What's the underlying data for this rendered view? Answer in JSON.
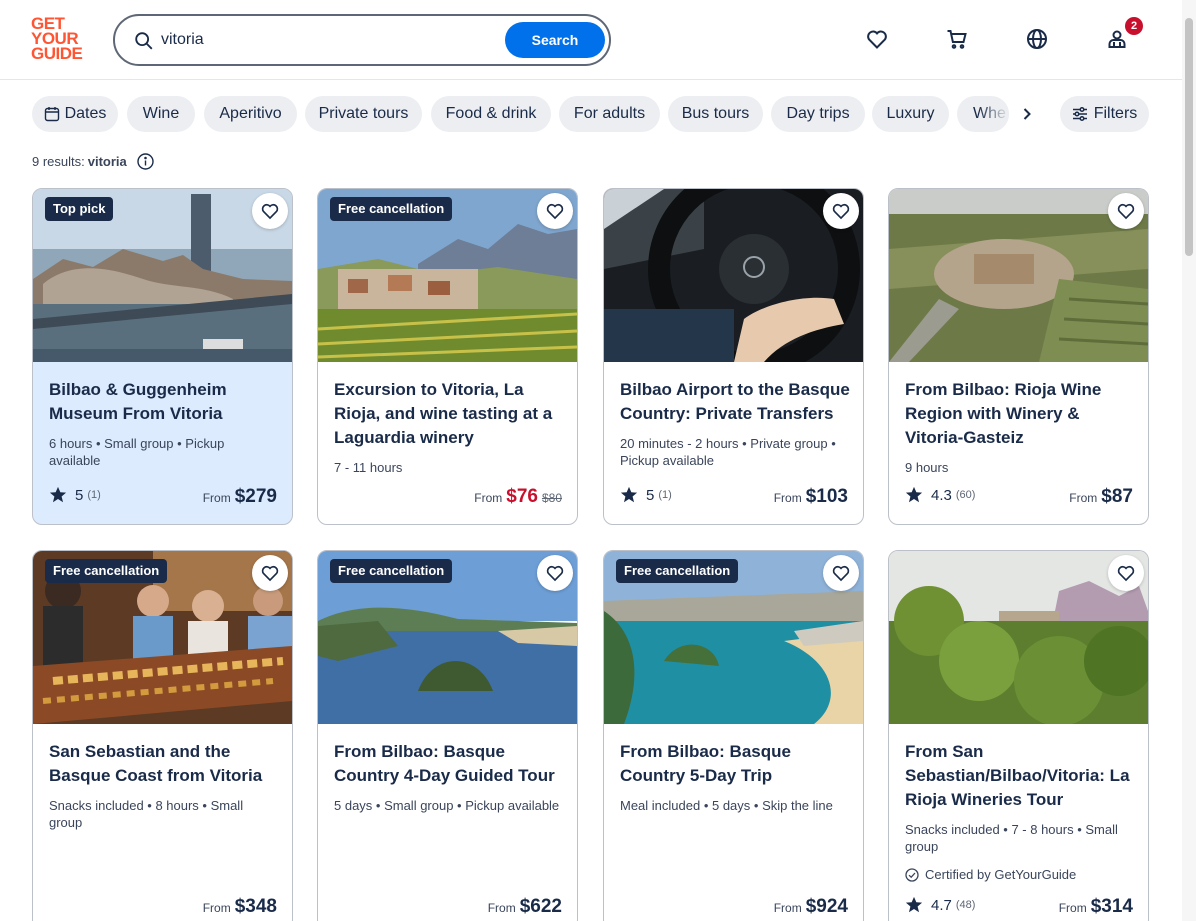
{
  "header": {
    "logo_lines": [
      "GET",
      "YOUR",
      "GUIDE"
    ],
    "search_value": "vitoria",
    "search_button": "Search",
    "cart_badge": "2",
    "icons": [
      "heart-icon",
      "cart-icon",
      "globe-icon",
      "user-icon"
    ]
  },
  "chips": [
    "Dates",
    "Wine",
    "Aperitivo",
    "Private tours",
    "Food & drink",
    "For adults",
    "Bus tours",
    "Day trips",
    "Luxury",
    "Whe"
  ],
  "filters_label": "Filters",
  "results_label": "9 results: ",
  "results_query": "vitoria",
  "colors": {
    "brand": "#ff5533",
    "accent": "#0071eb",
    "navy": "#1a2b49",
    "sale": "#c8102e"
  },
  "cards": [
    {
      "tag": "Top pick",
      "title": "Bilbao & Guggenheim Museum From Vitoria",
      "meta": "6 hours • Small group • Pickup available",
      "rating": "5",
      "reviews": "(1)",
      "from": "From",
      "price": "$279"
    },
    {
      "tag": "Free cancellation",
      "title": "Excursion to Vitoria, La Rioja, and wine tasting at a Laguardia winery",
      "meta": "7 - 11 hours",
      "from": "From",
      "price": "$76",
      "old_price": "$80"
    },
    {
      "title": "Bilbao Airport to the Basque Country: Private Transfers",
      "meta": "20 minutes - 2 hours • Private group • Pickup available",
      "rating": "5",
      "reviews": "(1)",
      "from": "From",
      "price": "$103"
    },
    {
      "title": "From Bilbao: Rioja Wine Region with Winery & Vitoria-Gasteiz",
      "meta": "9 hours",
      "rating": "4.3",
      "reviews": "(60)",
      "from": "From",
      "price": "$87"
    },
    {
      "tag": "Free cancellation",
      "title": "San Sebastian and the Basque Coast from Vitoria",
      "meta": "Snacks included • 8 hours • Small group",
      "from": "From",
      "price": "$348"
    },
    {
      "tag": "Free cancellation",
      "title": "From Bilbao: Basque Country 4-Day Guided Tour",
      "meta": "5 days • Small group • Pickup available",
      "from": "From",
      "price": "$622"
    },
    {
      "tag": "Free cancellation",
      "title": "From Bilbao: Basque Country 5-Day Trip",
      "meta": "Meal included • 5 days • Skip the line",
      "from": "From",
      "price": "$924"
    },
    {
      "title": "From San Sebastian/Bilbao/Vitoria: La Rioja Wineries Tour",
      "meta": "Snacks included • 7 - 8 hours • Small group",
      "certified": "Certified by GetYourGuide",
      "rating": "4.7",
      "reviews": "(48)",
      "from": "From",
      "price": "$314"
    }
  ]
}
